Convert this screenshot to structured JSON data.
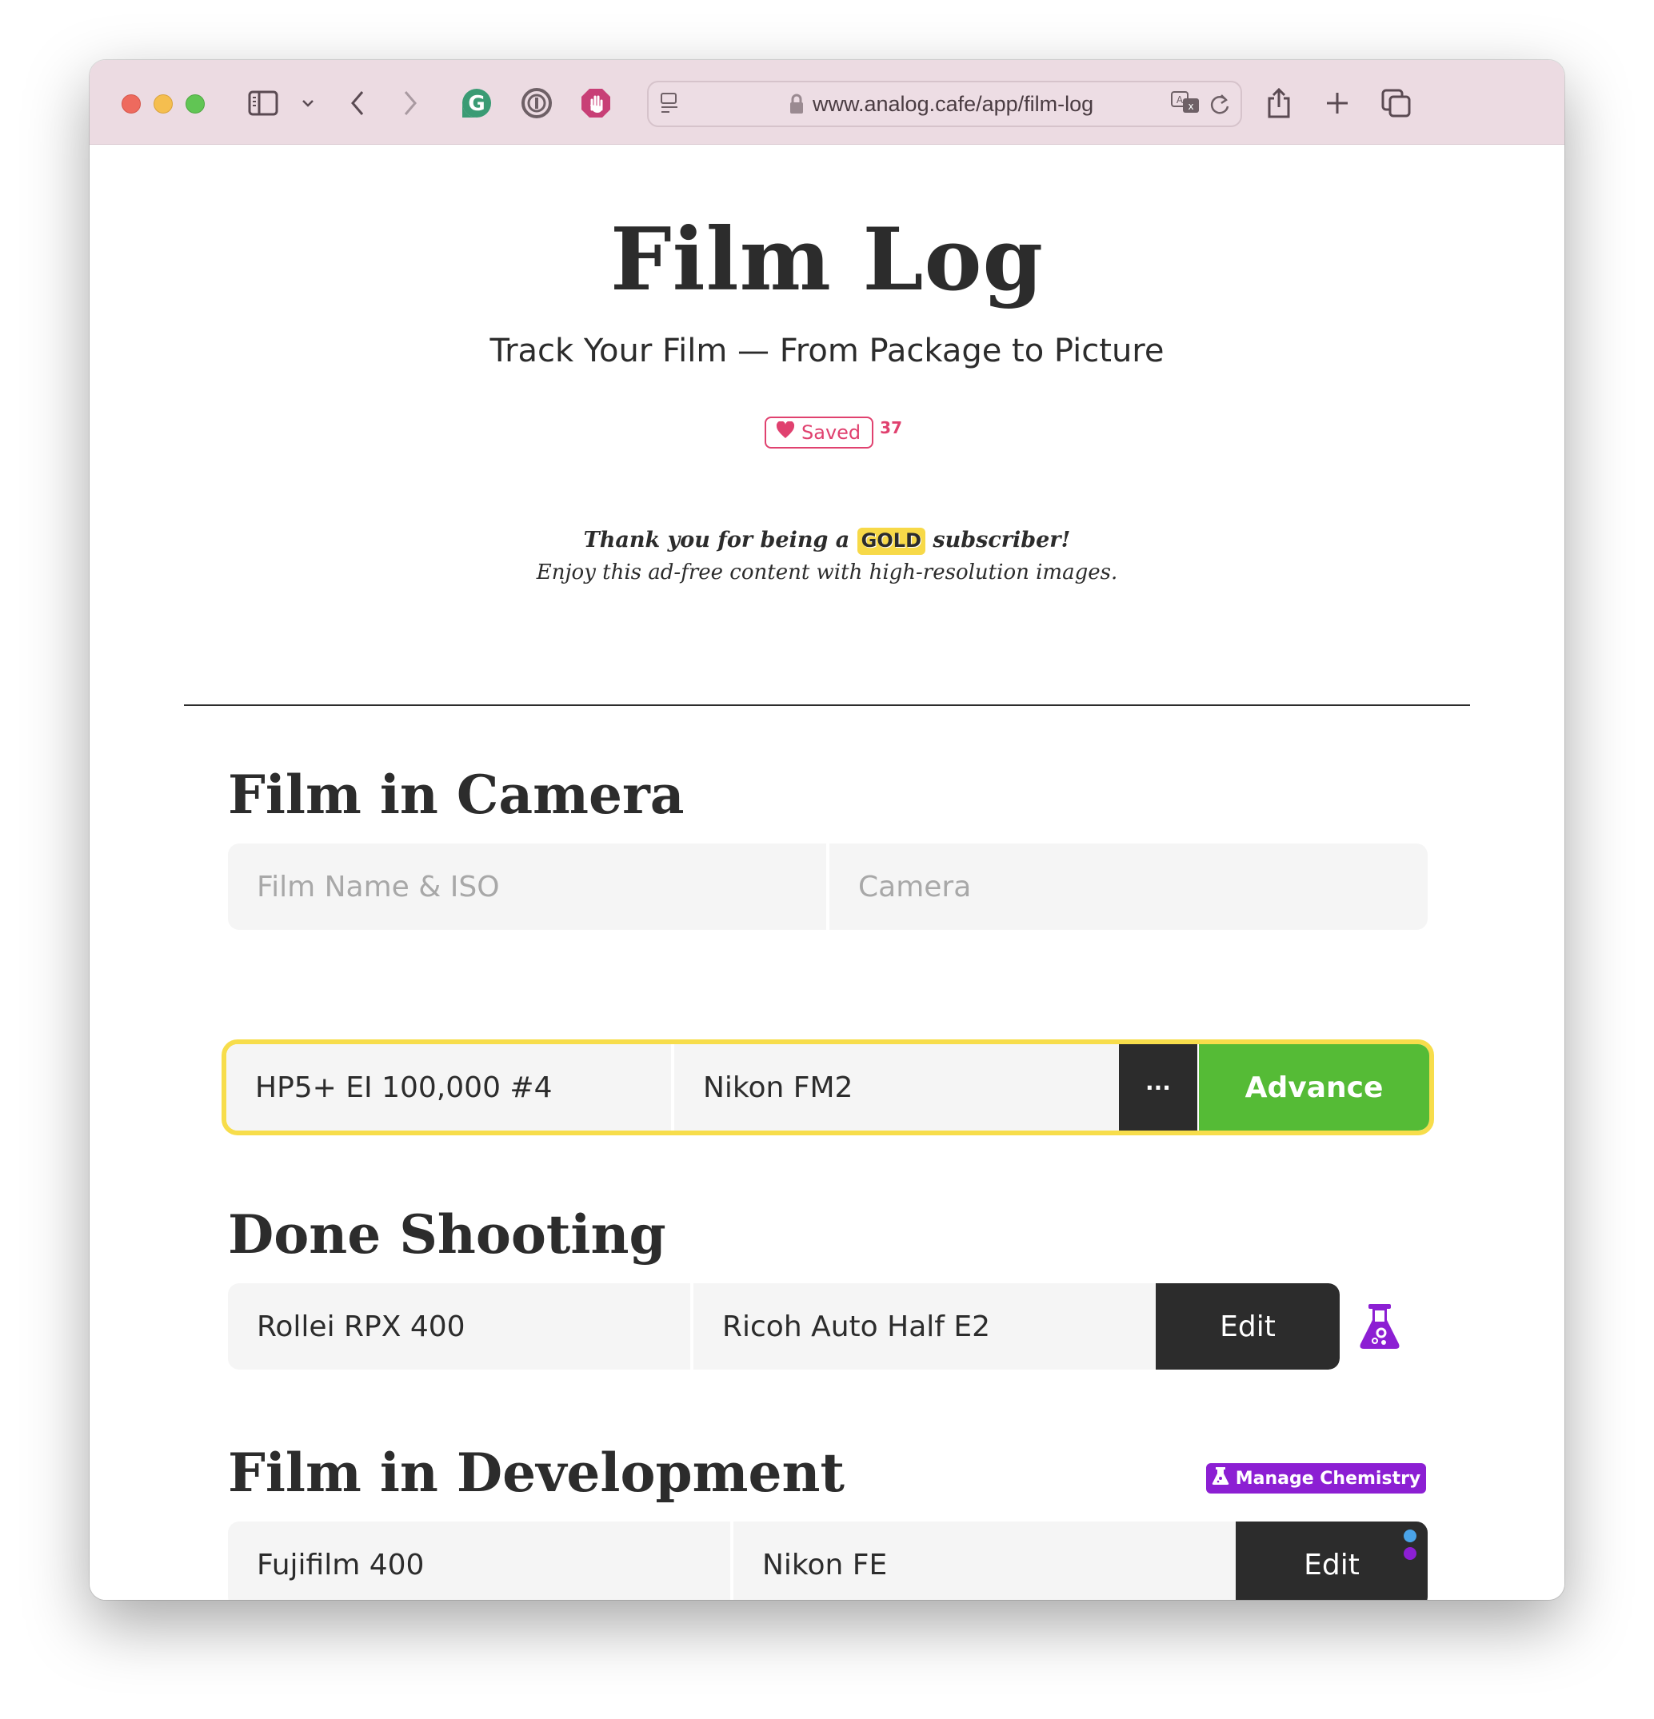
{
  "browser": {
    "url": "www.analog.cafe/app/film-log",
    "icons": [
      "sidebar-icon",
      "chevron-down-icon",
      "back-icon",
      "forward-icon",
      "grammarly-icon",
      "1password-icon",
      "adblock-icon",
      "reader-icon",
      "lock-icon",
      "translate-icon",
      "reload-icon",
      "share-icon",
      "new-tab-icon",
      "tabs-overview-icon"
    ]
  },
  "header": {
    "title": "Film Log",
    "subtitle": "Track Your Film — From Package to Picture",
    "saved_label": "Saved",
    "saved_count": "37"
  },
  "subscriber": {
    "thanks_prefix": "Thank you for being a",
    "tier": "GOLD",
    "thanks_suffix": "subscriber!",
    "message": "Enjoy this ad-free content with high-resolution images."
  },
  "film_in_camera": {
    "heading": "Film in Camera",
    "film_placeholder": "Film Name & ISO",
    "camera_placeholder": "Camera",
    "active": {
      "film": "HP5+ EI 100,000 #4",
      "camera": "Nikon FM2",
      "more_label": "···",
      "advance_label": "Advance"
    }
  },
  "done_shooting": {
    "heading": "Done Shooting",
    "items": [
      {
        "film": "Rollei RPX 400",
        "camera": "Ricoh Auto Half E2",
        "edit_label": "Edit"
      }
    ]
  },
  "film_in_development": {
    "heading": "Film in Development",
    "manage_label": "Manage Chemistry",
    "items": [
      {
        "film": "Fujifilm 400",
        "camera": "Nikon FE",
        "edit_label": "Edit"
      }
    ]
  },
  "colors": {
    "accent_pink": "#e0416f",
    "gold": "#f7d948",
    "advance_green": "#55bb36",
    "chemistry_purple": "#8c1fd3",
    "dark": "#2c2c2c",
    "dot_blue": "#4aa3e8",
    "dot_purple": "#8c1fd3"
  }
}
